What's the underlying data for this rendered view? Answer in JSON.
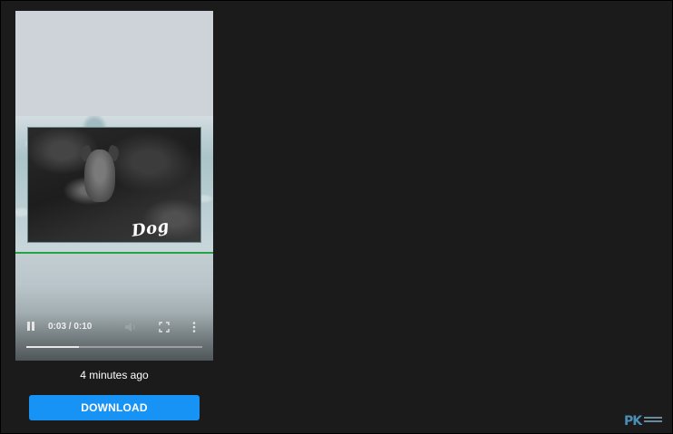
{
  "video": {
    "overlay_text": "Dog",
    "time_display": "0:03 / 0:10",
    "progress_fraction": 0.3,
    "accent_line_color": "#22a345"
  },
  "card": {
    "timestamp": "4 minutes ago",
    "download_label": "DOWNLOAD",
    "download_color": "#1792f5"
  },
  "watermark": {
    "letters": "PK"
  },
  "icons": {
    "play_pause": "pause-icon",
    "volume": "volume-icon",
    "fullscreen": "fullscreen-icon",
    "more": "more-vertical-icon"
  }
}
